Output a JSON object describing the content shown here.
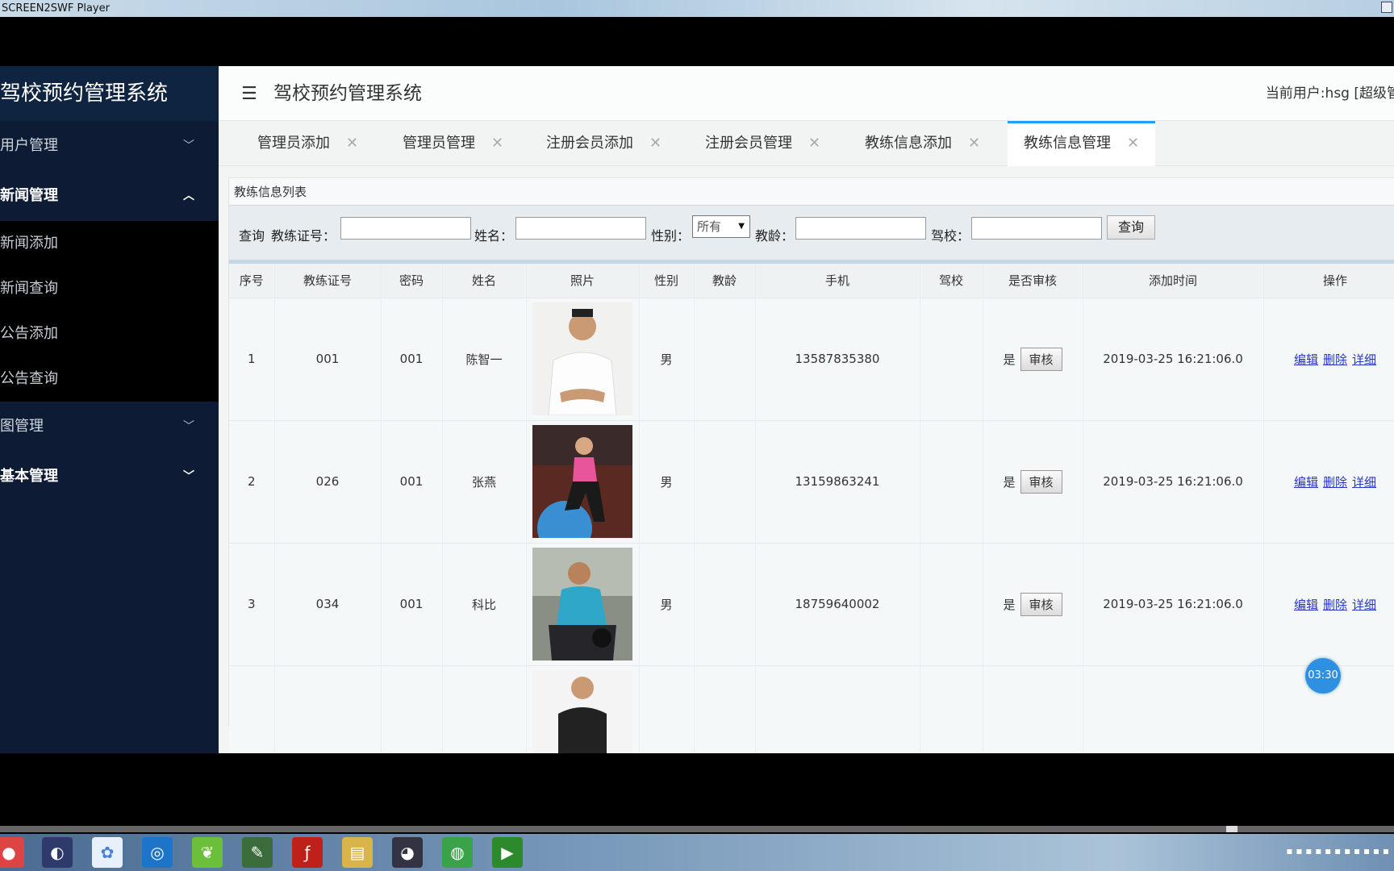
{
  "window": {
    "title": "SCREEN2SWF Player"
  },
  "sidebar": {
    "brand": "驾校预约管理系统",
    "menu": [
      {
        "label": "用户管理",
        "open": false
      },
      {
        "label": "新闻管理",
        "open": true
      },
      {
        "label": "图管理",
        "open": false
      },
      {
        "label": "基本管理",
        "open": false
      }
    ],
    "submenu": [
      "新闻添加",
      "新闻查询",
      "公告添加",
      "公告查询"
    ]
  },
  "topbar": {
    "title": "驾校预约管理系统",
    "current_user": "当前用户:hsg [超级管"
  },
  "tabs": [
    {
      "label": "管理员添加"
    },
    {
      "label": "管理员管理"
    },
    {
      "label": "注册会员添加"
    },
    {
      "label": "注册会员管理"
    },
    {
      "label": "教练信息添加"
    },
    {
      "label": "教练信息管理"
    }
  ],
  "panel": {
    "title": "教练信息列表"
  },
  "search": {
    "query_label": "查询",
    "license_label": "教练证号：",
    "name_label": "姓名：",
    "gender_label": "性别：",
    "gender_value": "所有",
    "age_label": "教龄：",
    "school_label": "驾校：",
    "button": "查询"
  },
  "table": {
    "headers": [
      "序号",
      "教练证号",
      "密码",
      "姓名",
      "照片",
      "性别",
      "教龄",
      "手机",
      "驾校",
      "是否审核",
      "添加时间",
      "操作"
    ],
    "rows": [
      {
        "no": "1",
        "license": "001",
        "password": "001",
        "name": "陈智一",
        "gender": "男",
        "age": "",
        "phone": "13587835380",
        "school": "",
        "approved": "是",
        "review": "审核",
        "time": "2019-03-25 16:21:06.0"
      },
      {
        "no": "2",
        "license": "026",
        "password": "001",
        "name": "张燕",
        "gender": "男",
        "age": "",
        "phone": "13159863241",
        "school": "",
        "approved": "是",
        "review": "审核",
        "time": "2019-03-25 16:21:06.0"
      },
      {
        "no": "3",
        "license": "034",
        "password": "001",
        "name": "科比",
        "gender": "男",
        "age": "",
        "phone": "18759640002",
        "school": "",
        "approved": "是",
        "review": "审核",
        "time": "2019-03-25 16:21:06.0"
      }
    ],
    "ops": {
      "edit": "编辑",
      "delete": "删除",
      "detail": "详细"
    }
  },
  "timer": "03:30",
  "colors": {
    "sidebar": "#0d1c34",
    "accent": "#1e9fff",
    "link": "#2a35c7"
  }
}
